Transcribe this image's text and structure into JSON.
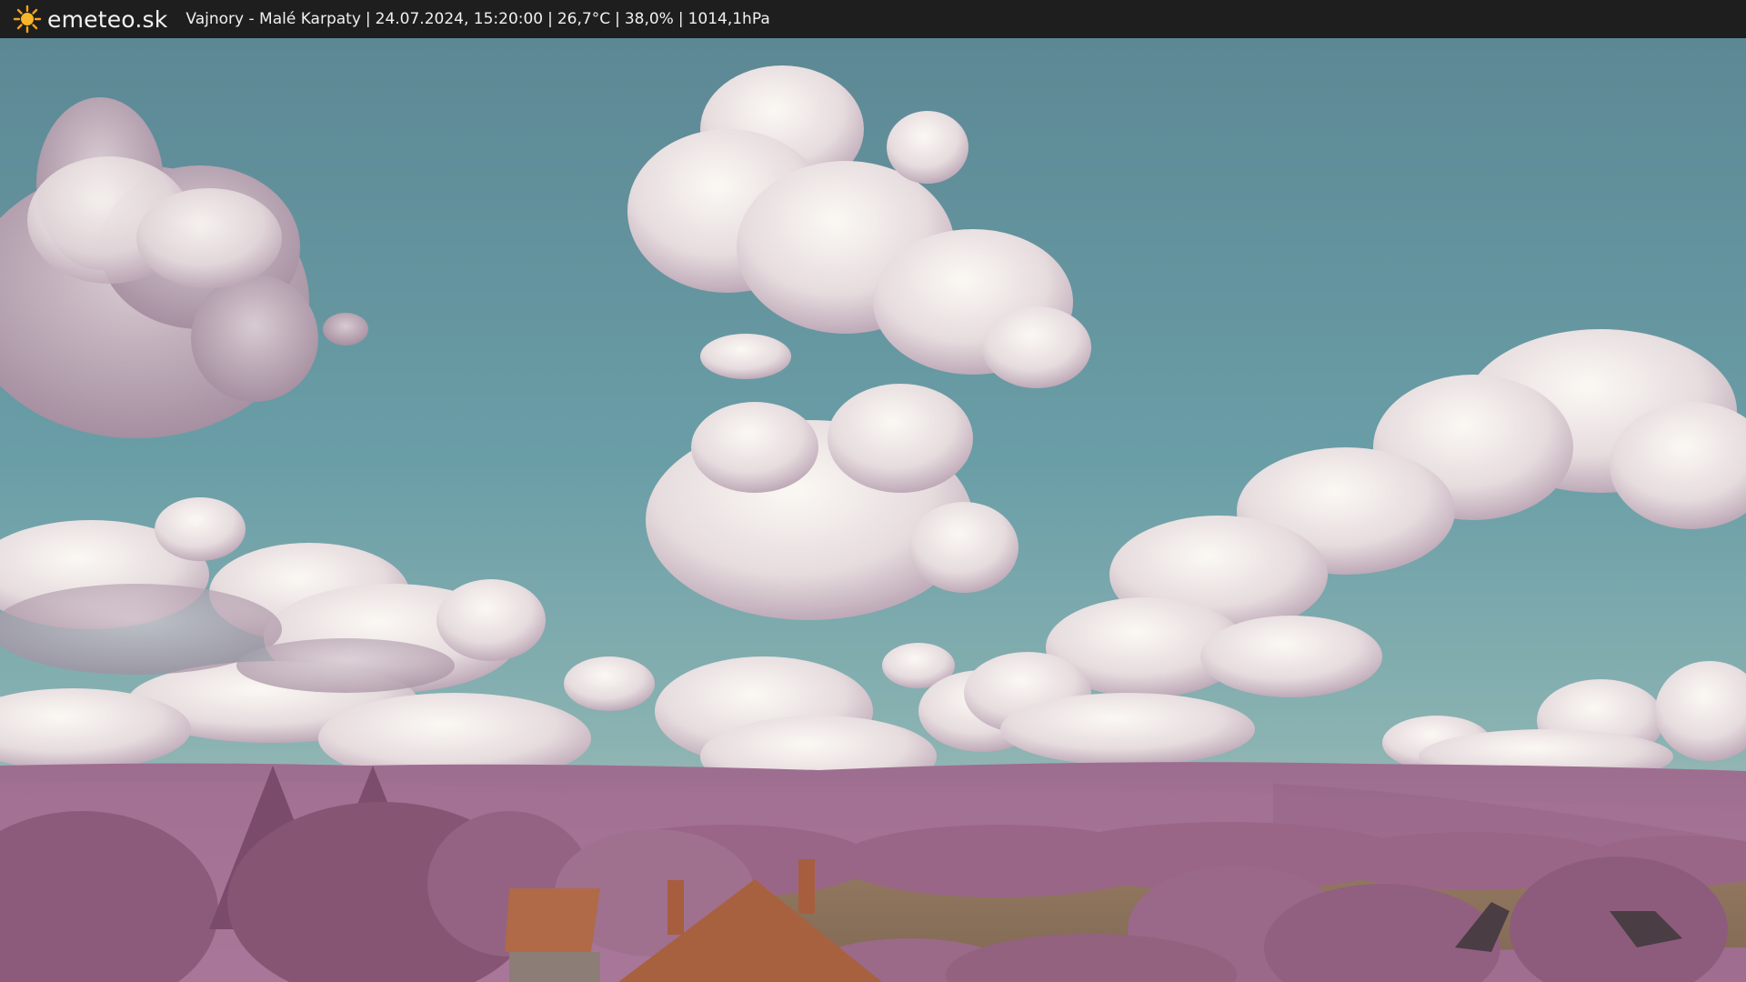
{
  "header": {
    "brand": "emeteo.sk",
    "logo_icon": "sun-icon",
    "location": "Vajnory - Malé Karpaty",
    "datetime": "24.07.2024, 15:20:00",
    "temperature": "26,7°C",
    "humidity": "38,0%",
    "pressure": "1014,1hPa",
    "separator": "|"
  },
  "colors": {
    "bar_background": "#1e1e1e",
    "sun": "#f5a31a",
    "sky_top": "#5e8a96",
    "sky_mid": "#6fa2aa",
    "hills": "#a67496",
    "foliage": "#9a6a88",
    "roof": "#b06a48",
    "field": "#8e7560"
  }
}
